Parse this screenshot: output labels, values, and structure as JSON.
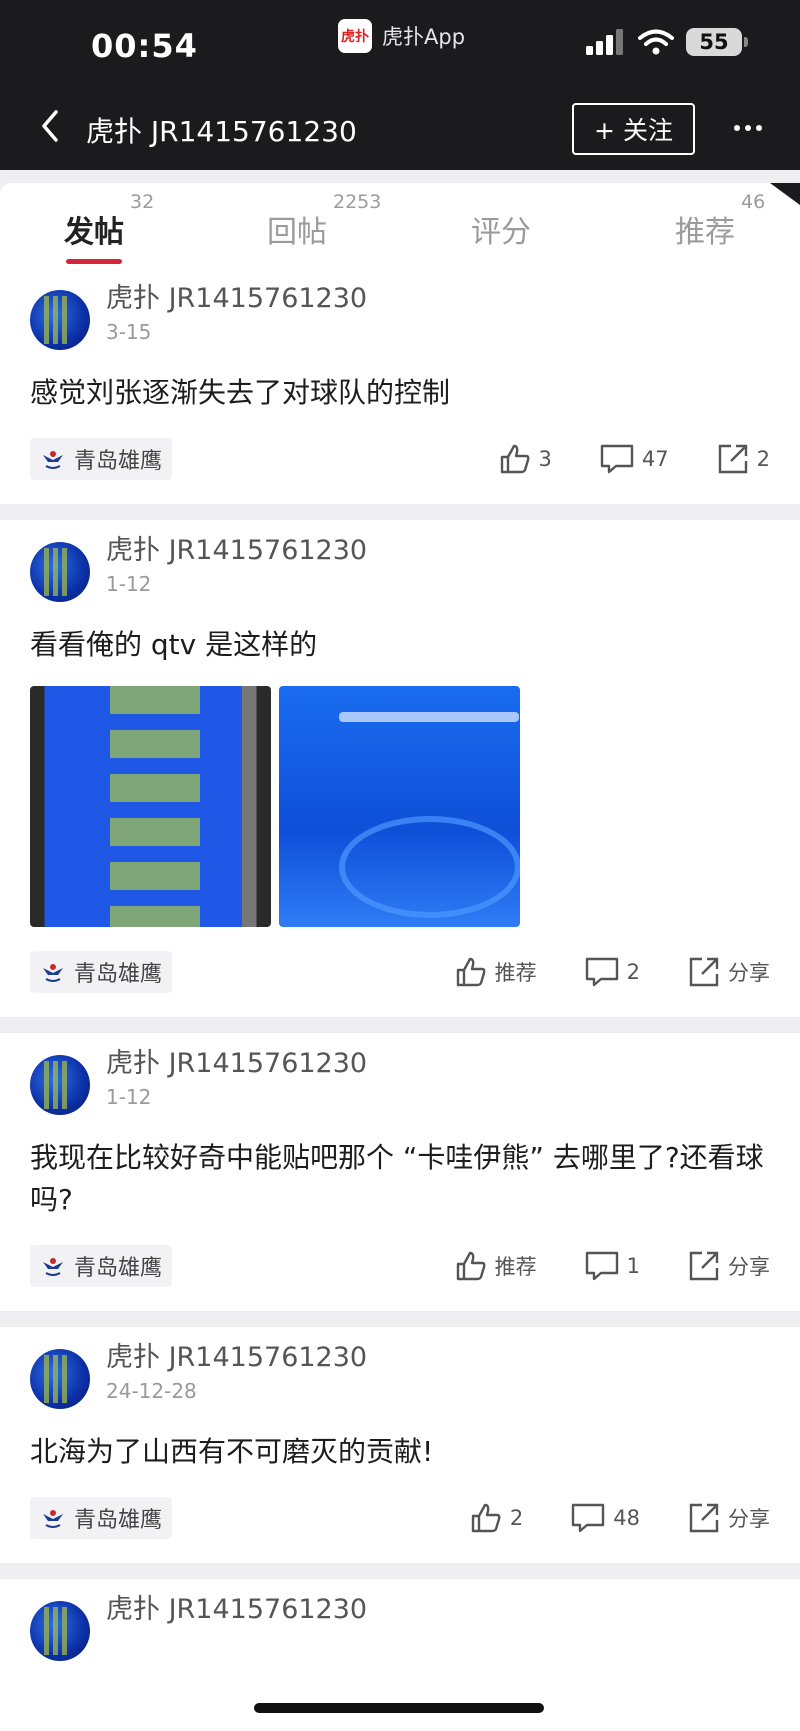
{
  "status_bar": {
    "time": "00:54",
    "app_logo_text": "虎扑",
    "app_name": "虎扑App",
    "battery": "55"
  },
  "nav": {
    "title": "虎扑 JR1415761230",
    "follow_label": "+ 关注"
  },
  "tabs": [
    {
      "label": "发帖",
      "count": "32"
    },
    {
      "label": "回帖",
      "count": "2253"
    },
    {
      "label": "评分",
      "count": ""
    },
    {
      "label": "推荐",
      "count": "46"
    }
  ],
  "posts": [
    {
      "author": "虎扑 JR1415761230",
      "date": "3-15",
      "text": "感觉刘张逐渐失去了对球队的控制",
      "tag": "青岛雄鹰",
      "likes": "3",
      "comments": "47",
      "shares": "2"
    },
    {
      "author": "虎扑 JR1415761230",
      "date": "1-12",
      "text": "看看俺的 qtv 是这样的",
      "tag": "青岛雄鹰",
      "likes": "推荐",
      "comments": "2",
      "shares": "分享"
    },
    {
      "author": "虎扑 JR1415761230",
      "date": "1-12",
      "text": "我现在比较好奇中能贴吧那个 “卡哇伊熊” 去哪里了?还看球吗?",
      "tag": "青岛雄鹰",
      "likes": "推荐",
      "comments": "1",
      "shares": "分享"
    },
    {
      "author": "虎扑 JR1415761230",
      "date": "24-12-28",
      "text": "北海为了山西有不可磨灭的贡献!",
      "tag": "青岛雄鹰",
      "likes": "2",
      "comments": "48",
      "shares": "分享"
    },
    {
      "author": "虎扑 JR1415761230"
    }
  ],
  "colors": {
    "topbar": "#1b1b1d",
    "accent": "#d6263b",
    "background": "#efeff1"
  }
}
